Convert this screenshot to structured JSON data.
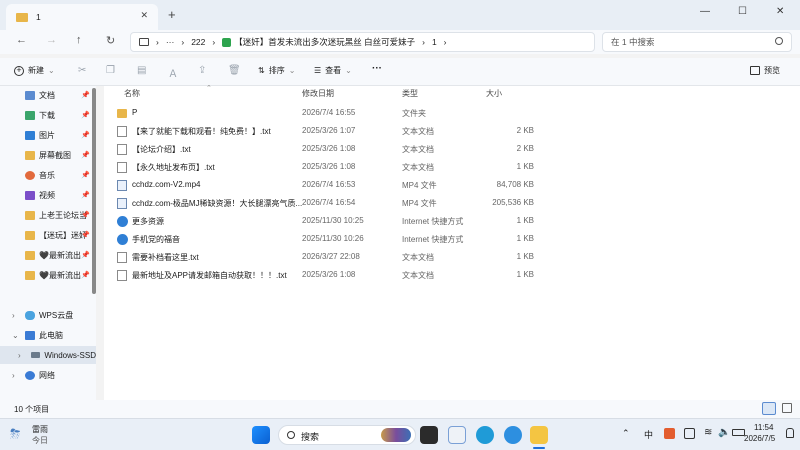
{
  "tab": {
    "title": "1",
    "close": "✕",
    "new": "+"
  },
  "window": {
    "minimize": "—",
    "maximize": "☐",
    "close": "✕"
  },
  "nav": {
    "back": "←",
    "forward": "→",
    "up": "↑",
    "refresh": "↻"
  },
  "breadcrumb": {
    "more": "···",
    "items": [
      "222",
      "【迷奸】首发未流出多次迷玩黑丝 白丝可爱妹子",
      "1"
    ],
    "sep": "›",
    "chevron": "›"
  },
  "search": {
    "placeholder": "在 1 中搜索"
  },
  "toolbar": {
    "new_label": "新建",
    "sort_label": "排序",
    "view_label": "查看",
    "more": "···",
    "preview_label": "预览"
  },
  "sidebar": {
    "items": [
      {
        "label": "文档",
        "pinned": true,
        "color": "#5b8bd0"
      },
      {
        "label": "下载",
        "pinned": true,
        "color": "#3aa56b"
      },
      {
        "label": "图片",
        "pinned": true,
        "color": "#2f7fd5"
      },
      {
        "label": "屏幕截图",
        "pinned": true,
        "color": "#e8b64a"
      },
      {
        "label": "音乐",
        "pinned": true,
        "color": "#e26a3d"
      },
      {
        "label": "视频",
        "pinned": true,
        "color": "#7b4fc9"
      },
      {
        "label": "上老王论坛当",
        "pinned": true,
        "color": "#e8b64a"
      },
      {
        "label": "【迷玩】迷奸",
        "pinned": true,
        "color": "#e8b64a"
      },
      {
        "label": "🖤最新流出",
        "pinned": true,
        "color": "#e8b64a"
      },
      {
        "label": "🖤最新流出",
        "pinned": true,
        "color": "#e8b64a"
      }
    ],
    "tree": [
      {
        "label": "WPS云盘",
        "expander": "›"
      },
      {
        "label": "此电脑",
        "expander": "⌄"
      },
      {
        "label": "Windows-SSD",
        "expander": "›"
      },
      {
        "label": "网络",
        "expander": "›"
      }
    ]
  },
  "columns": {
    "name": "名称",
    "modified": "修改日期",
    "type": "类型",
    "size": "大小"
  },
  "files": [
    {
      "name": "P",
      "modified": "2026/7/4 16:55",
      "type": "文件夹",
      "size": "",
      "kind": "folder"
    },
    {
      "name": "【来了就能下载和观看！纯免费！】.txt",
      "modified": "2025/3/26 1:07",
      "type": "文本文档",
      "size": "2 KB",
      "kind": "txt"
    },
    {
      "name": "【论坛介绍】.txt",
      "modified": "2025/3/26 1:08",
      "type": "文本文档",
      "size": "2 KB",
      "kind": "txt"
    },
    {
      "name": "【永久地址发布页】.txt",
      "modified": "2025/3/26 1:08",
      "type": "文本文档",
      "size": "1 KB",
      "kind": "txt"
    },
    {
      "name": "cchdz.com-V2.mp4",
      "modified": "2026/7/4 16:53",
      "type": "MP4 文件",
      "size": "84,708 KB",
      "kind": "mp4"
    },
    {
      "name": "cchdz.com-极品MJ稀缺资源！大长腿漂亮气质...",
      "modified": "2026/7/4 16:54",
      "type": "MP4 文件",
      "size": "205,536 KB",
      "kind": "mp4"
    },
    {
      "name": "更多资源",
      "modified": "2025/11/30 10:25",
      "type": "Internet 快捷方式",
      "size": "1 KB",
      "kind": "url"
    },
    {
      "name": "手机党的福音",
      "modified": "2025/11/30 10:26",
      "type": "Internet 快捷方式",
      "size": "1 KB",
      "kind": "url"
    },
    {
      "name": "需要补档看这里.txt",
      "modified": "2026/3/27 22:08",
      "type": "文本文档",
      "size": "1 KB",
      "kind": "txt"
    },
    {
      "name": "最新地址及APP请发邮箱自动获取！！！.txt",
      "modified": "2025/3/26 1:08",
      "type": "文本文档",
      "size": "1 KB",
      "kind": "txt"
    }
  ],
  "status": {
    "count": "10 个项目"
  },
  "taskbar": {
    "weather_title": "雷雨",
    "weather_sub": "今日",
    "search_label": "搜索",
    "tray_lang": "中",
    "clock_time": "11:54",
    "clock_date": "2026/7/5"
  }
}
